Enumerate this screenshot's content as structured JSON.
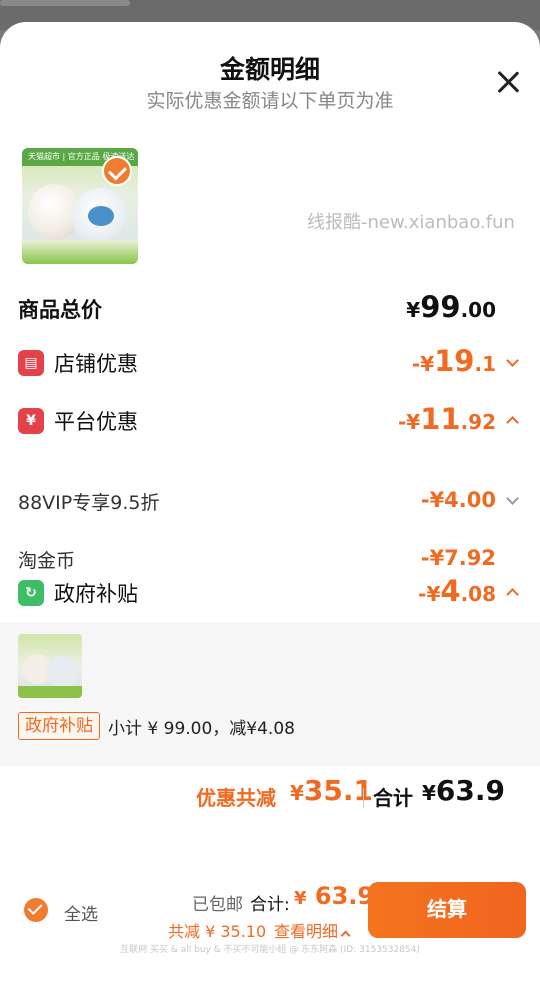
{
  "sheet": {
    "title": "金额明细",
    "subtitle": "实际优惠金额请以下单页为准"
  },
  "product": {
    "tag_text": "天猫超市 | 官方正品 极速送达",
    "selected": true
  },
  "watermark": "线报酷-new.xianbao.fun",
  "rows": {
    "total_price": {
      "label": "商品总价",
      "currency": "¥",
      "integer": "99",
      "decimal": ".00"
    },
    "store_discount": {
      "label": "店铺优惠",
      "prefix": "-¥",
      "integer": "19",
      "decimal": ".1",
      "icon": "store-icon",
      "expanded": false
    },
    "platform_discount": {
      "label": "平台优惠",
      "prefix": "-¥",
      "integer": "11",
      "decimal": ".92",
      "icon": "coupon-icon",
      "expanded": true
    },
    "vip": {
      "label": "88VIP专享9.5折",
      "amount": "-¥4.00",
      "expanded": false
    },
    "coin": {
      "label": "淘金币",
      "amount": "-¥7.92"
    },
    "gov_subsidy": {
      "label": "政府补贴",
      "prefix": "-¥",
      "integer": "4",
      "decimal": ".08",
      "icon": "refresh-icon",
      "expanded": true
    }
  },
  "subsidy_detail": {
    "tag": "政府补贴",
    "subtotal_text": "小计 ¥ 99.00，减¥4.08"
  },
  "summary": {
    "discount_label": "优惠共减",
    "discount_currency": "¥",
    "discount_amount": "35.1",
    "total_label": "合计",
    "total_currency": "¥",
    "total_amount": "63.9"
  },
  "bottom_bar": {
    "select_all_label": "全选",
    "shipping": "已包邮",
    "total_label": "合计:",
    "total_currency": "¥",
    "total_amount": "63.9",
    "discount_text": "共减 ¥ 35.10",
    "detail_link": "查看明细",
    "checkout_label": "结算"
  },
  "footer_watermark": "互联网 买买 & all buy & 不买不可能小组 @ 东东阿森 (ID: 3153532854)",
  "colors": {
    "accent": "#f06a22",
    "store_icon_bg": "#e5414b",
    "subsidy_icon_bg": "#3cbd66"
  }
}
